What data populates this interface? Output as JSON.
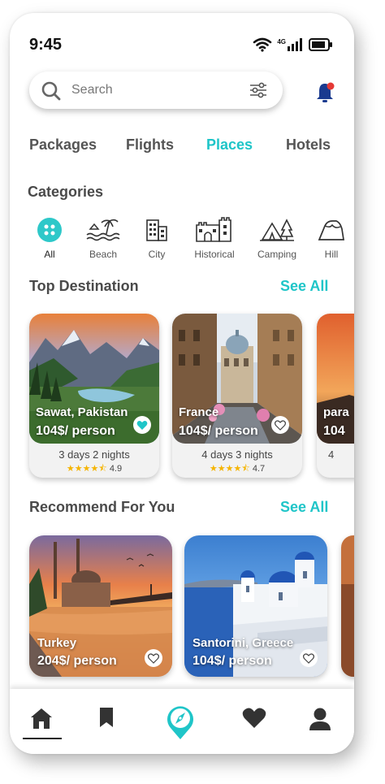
{
  "status_bar": {
    "time": "9:45",
    "network": "4G"
  },
  "search": {
    "placeholder": "Search"
  },
  "tabs": [
    {
      "label": "Packages",
      "active": false
    },
    {
      "label": "Flights",
      "active": false
    },
    {
      "label": "Places",
      "active": true
    },
    {
      "label": "Hotels",
      "active": false
    }
  ],
  "categories": {
    "title": "Categories",
    "items": [
      {
        "label": "All",
        "icon": "grid-icon",
        "selected": true
      },
      {
        "label": "Beach",
        "icon": "beach-icon"
      },
      {
        "label": "City",
        "icon": "city-icon"
      },
      {
        "label": "Historical",
        "icon": "castle-icon"
      },
      {
        "label": "Camping",
        "icon": "tent-icon"
      },
      {
        "label": "Hill",
        "icon": "hill-icon"
      }
    ]
  },
  "top_destination": {
    "title": "Top Destination",
    "see_all": "See All",
    "cards": [
      {
        "name": "Sawat, Pakistan",
        "price": "104$/ person",
        "nights": "3 days 2 nights",
        "rating": "4.9",
        "stars": "★★★★⯪",
        "liked": true
      },
      {
        "name": "France",
        "price": "104$/ person",
        "nights": "4 days 3 nights",
        "rating": "4.7",
        "stars": "★★★★⯪",
        "liked": false
      },
      {
        "name": "para",
        "price": "104",
        "nights": "4",
        "rating": "",
        "stars": "",
        "liked": false
      }
    ]
  },
  "recommend": {
    "title": "Recommend For You",
    "see_all": "See All",
    "cards": [
      {
        "name": "Turkey",
        "price": "204$/ person"
      },
      {
        "name": "Santorini, Greece",
        "price": "104$/ person"
      }
    ]
  },
  "colors": {
    "accent": "#1fc5c8",
    "notification_dot": "#e53935",
    "bell": "#1a3a8f",
    "star": "#f5b400"
  },
  "bottom_nav": [
    {
      "icon": "home-icon",
      "active": true
    },
    {
      "icon": "bookmark-icon"
    },
    {
      "icon": "compass-icon"
    },
    {
      "icon": "heart-icon"
    },
    {
      "icon": "profile-icon"
    }
  ]
}
